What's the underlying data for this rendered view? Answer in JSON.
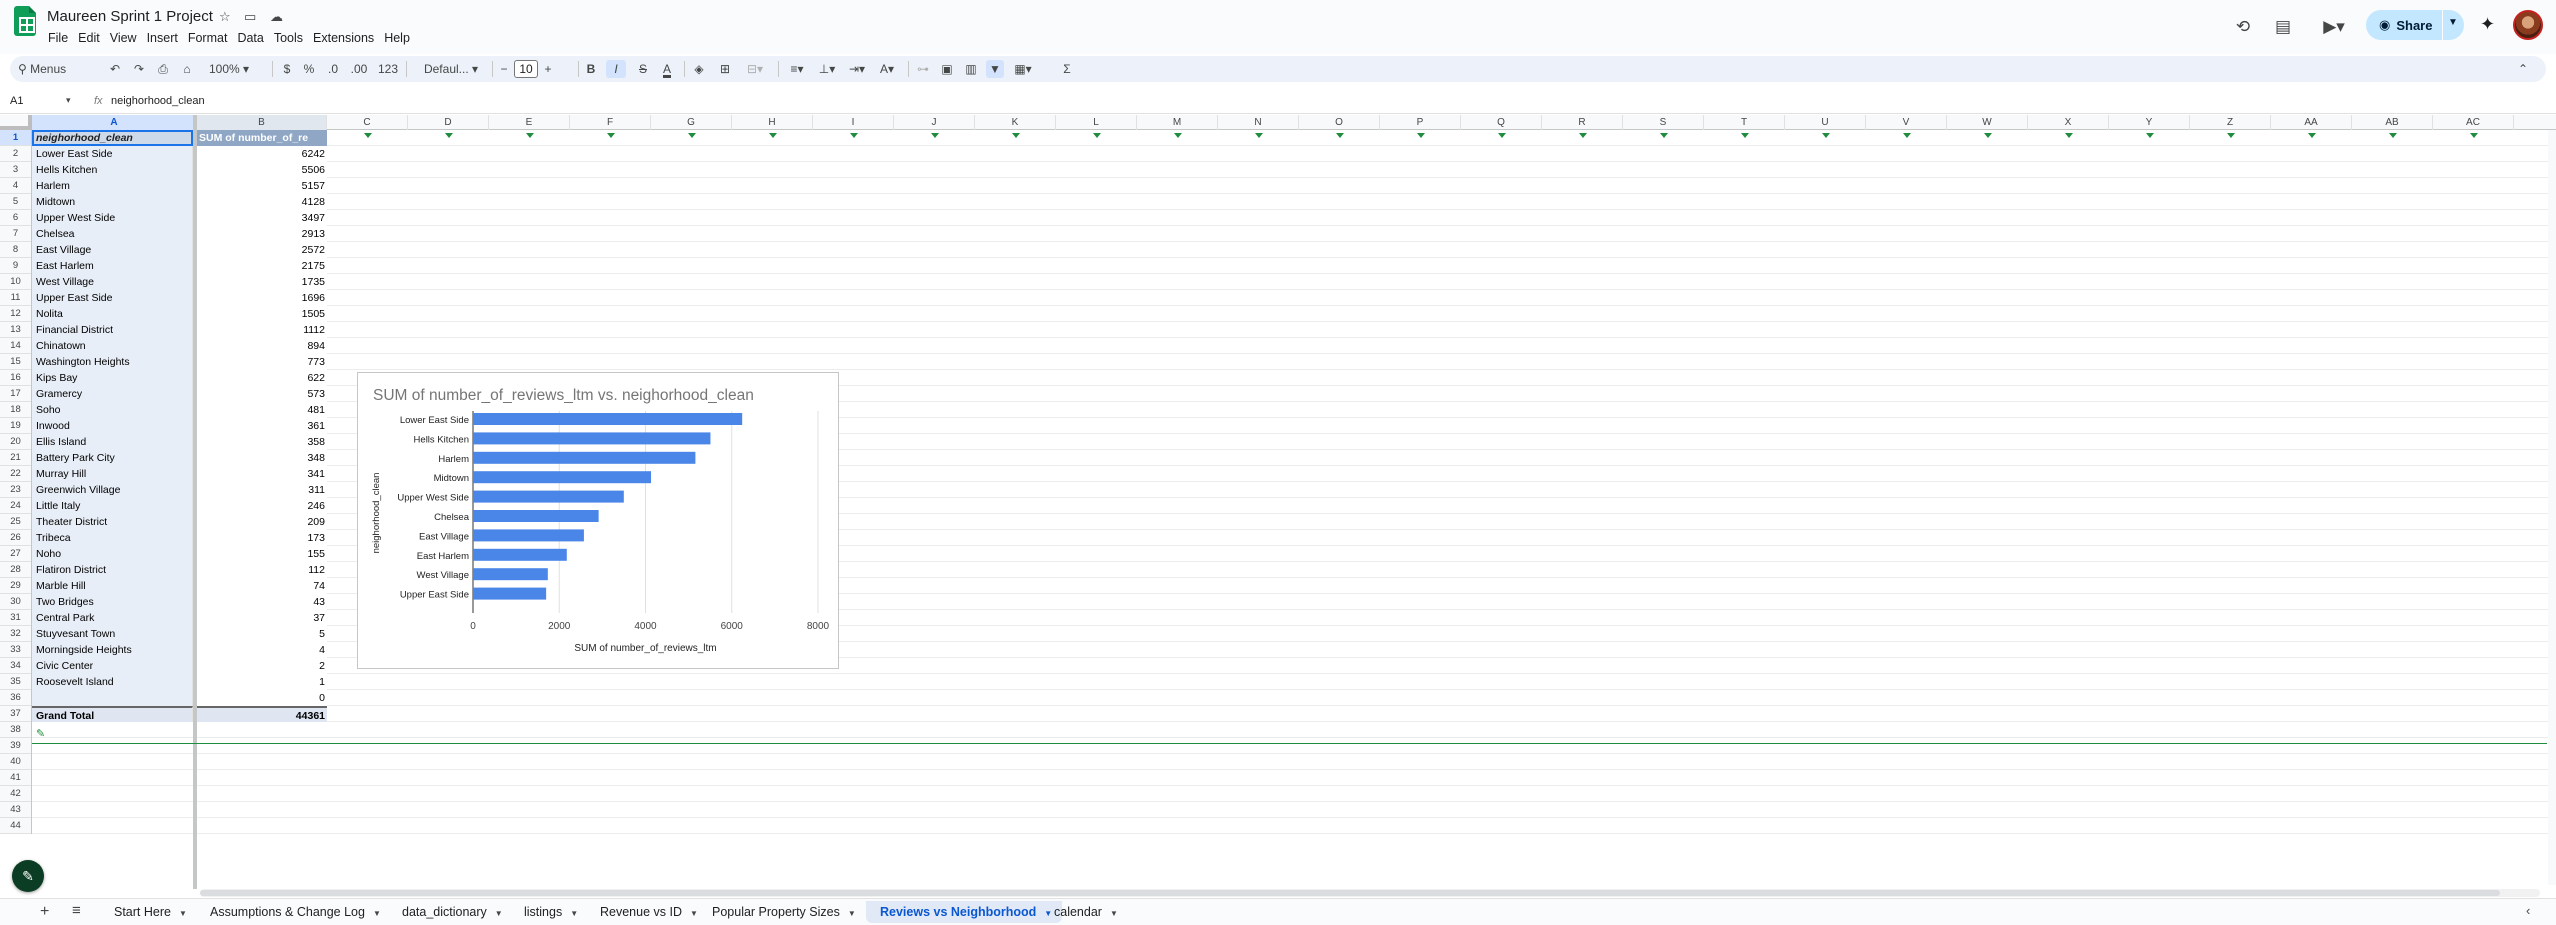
{
  "app": {
    "title": "Maureen Sprint 1 Project",
    "menus": [
      "File",
      "Edit",
      "View",
      "Insert",
      "Format",
      "Data",
      "Tools",
      "Extensions",
      "Help"
    ],
    "share_label": "Share"
  },
  "toolbar": {
    "menus_label": "Menus",
    "zoom": "100%",
    "currency": "$",
    "percent": "%",
    "dec_decrease": ".0",
    "dec_increase": ".00",
    "number_format": "123",
    "font": "Defaul...",
    "font_size": "10",
    "bold": "B",
    "italic": "I",
    "strike": "S",
    "text_color": "A",
    "sum": "Σ"
  },
  "formula_bar": {
    "cell_ref": "A1",
    "fx": "fx",
    "content": "neighorhood_clean"
  },
  "grid": {
    "columns": [
      "A",
      "B",
      "C",
      "D",
      "E",
      "F",
      "G",
      "H",
      "I",
      "J",
      "K",
      "L",
      "M",
      "N",
      "O",
      "P",
      "Q",
      "R",
      "S",
      "T",
      "U",
      "V",
      "W",
      "X",
      "Y",
      "Z",
      "AA",
      "AB",
      "AC"
    ],
    "header_row": {
      "a": "neighorhood_clean",
      "b": "SUM of number_of_re"
    },
    "rows": [
      {
        "a": "Lower East Side",
        "b": "6242"
      },
      {
        "a": "Hells Kitchen",
        "b": "5506"
      },
      {
        "a": "Harlem",
        "b": "5157"
      },
      {
        "a": "Midtown",
        "b": "4128"
      },
      {
        "a": "Upper West Side",
        "b": "3497"
      },
      {
        "a": "Chelsea",
        "b": "2913"
      },
      {
        "a": "East Village",
        "b": "2572"
      },
      {
        "a": "East Harlem",
        "b": "2175"
      },
      {
        "a": "West Village",
        "b": "1735"
      },
      {
        "a": "Upper East Side",
        "b": "1696"
      },
      {
        "a": "Nolita",
        "b": "1505"
      },
      {
        "a": "Financial District",
        "b": "1112"
      },
      {
        "a": "Chinatown",
        "b": "894"
      },
      {
        "a": "Washington Heights",
        "b": "773"
      },
      {
        "a": "Kips Bay",
        "b": "622"
      },
      {
        "a": "Gramercy",
        "b": "573"
      },
      {
        "a": "Soho",
        "b": "481"
      },
      {
        "a": "Inwood",
        "b": "361"
      },
      {
        "a": "Ellis Island",
        "b": "358"
      },
      {
        "a": "Battery Park City",
        "b": "348"
      },
      {
        "a": "Murray Hill",
        "b": "341"
      },
      {
        "a": "Greenwich Village",
        "b": "311"
      },
      {
        "a": "Little Italy",
        "b": "246"
      },
      {
        "a": "Theater District",
        "b": "209"
      },
      {
        "a": "Tribeca",
        "b": "173"
      },
      {
        "a": "Noho",
        "b": "155"
      },
      {
        "a": "Flatiron District",
        "b": "112"
      },
      {
        "a": "Marble Hill",
        "b": "74"
      },
      {
        "a": "Two Bridges",
        "b": "43"
      },
      {
        "a": "Central Park",
        "b": "37"
      },
      {
        "a": "Stuyvesant Town",
        "b": "5"
      },
      {
        "a": "Morningside Heights",
        "b": "4"
      },
      {
        "a": "Civic Center",
        "b": "2"
      },
      {
        "a": "Roosevelt Island",
        "b": "1"
      },
      {
        "a": "",
        "b": "0"
      }
    ],
    "total_row": {
      "a": "Grand Total",
      "b": "44361"
    },
    "row_count": 44
  },
  "chart_data": {
    "type": "bar",
    "orientation": "horizontal",
    "title": "SUM of number_of_reviews_ltm vs. neighorhood_clean",
    "xlabel": "SUM of number_of_reviews_ltm",
    "ylabel": "neighorhood_clean",
    "categories": [
      "Lower East Side",
      "Hells Kitchen",
      "Harlem",
      "Midtown",
      "Upper West Side",
      "Chelsea",
      "East Village",
      "East Harlem",
      "West Village",
      "Upper East Side"
    ],
    "values": [
      6242,
      5506,
      5157,
      4128,
      3497,
      2913,
      2572,
      2175,
      1735,
      1696
    ],
    "xlim": [
      0,
      8000
    ],
    "ticks": [
      "0",
      "2000",
      "4000",
      "6000",
      "8000"
    ],
    "bar_color": "#4a86e8",
    "grid": true
  },
  "tabs": [
    {
      "label": "Start Here",
      "active": false
    },
    {
      "label": "Assumptions & Change Log",
      "active": false
    },
    {
      "label": "data_dictionary",
      "active": false
    },
    {
      "label": "listings",
      "active": false
    },
    {
      "label": "Revenue vs ID",
      "active": false
    },
    {
      "label": "Popular Property Sizes",
      "active": false
    },
    {
      "label": "Reviews vs Neighborhood",
      "active": true
    },
    {
      "label": "calendar",
      "active": false
    }
  ]
}
